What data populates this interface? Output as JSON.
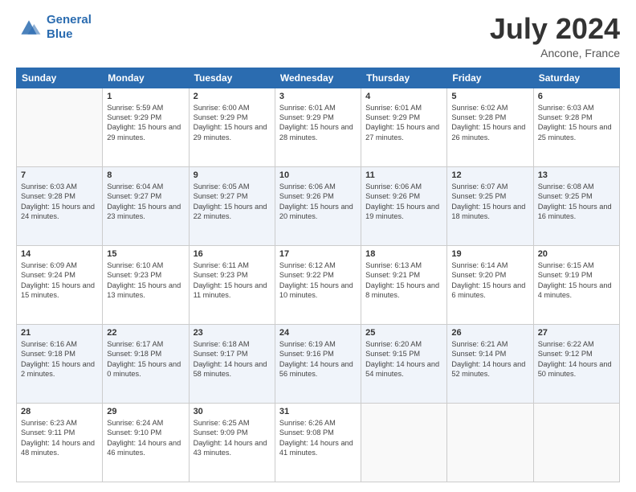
{
  "header": {
    "logo_line1": "General",
    "logo_line2": "Blue",
    "main_title": "July 2024",
    "subtitle": "Ancone, France"
  },
  "calendar": {
    "days_of_week": [
      "Sunday",
      "Monday",
      "Tuesday",
      "Wednesday",
      "Thursday",
      "Friday",
      "Saturday"
    ],
    "weeks": [
      [
        {
          "day": "",
          "sunrise": "",
          "sunset": "",
          "daylight": ""
        },
        {
          "day": "1",
          "sunrise": "Sunrise: 5:59 AM",
          "sunset": "Sunset: 9:29 PM",
          "daylight": "Daylight: 15 hours and 29 minutes."
        },
        {
          "day": "2",
          "sunrise": "Sunrise: 6:00 AM",
          "sunset": "Sunset: 9:29 PM",
          "daylight": "Daylight: 15 hours and 29 minutes."
        },
        {
          "day": "3",
          "sunrise": "Sunrise: 6:01 AM",
          "sunset": "Sunset: 9:29 PM",
          "daylight": "Daylight: 15 hours and 28 minutes."
        },
        {
          "day": "4",
          "sunrise": "Sunrise: 6:01 AM",
          "sunset": "Sunset: 9:29 PM",
          "daylight": "Daylight: 15 hours and 27 minutes."
        },
        {
          "day": "5",
          "sunrise": "Sunrise: 6:02 AM",
          "sunset": "Sunset: 9:28 PM",
          "daylight": "Daylight: 15 hours and 26 minutes."
        },
        {
          "day": "6",
          "sunrise": "Sunrise: 6:03 AM",
          "sunset": "Sunset: 9:28 PM",
          "daylight": "Daylight: 15 hours and 25 minutes."
        }
      ],
      [
        {
          "day": "7",
          "sunrise": "Sunrise: 6:03 AM",
          "sunset": "Sunset: 9:28 PM",
          "daylight": "Daylight: 15 hours and 24 minutes."
        },
        {
          "day": "8",
          "sunrise": "Sunrise: 6:04 AM",
          "sunset": "Sunset: 9:27 PM",
          "daylight": "Daylight: 15 hours and 23 minutes."
        },
        {
          "day": "9",
          "sunrise": "Sunrise: 6:05 AM",
          "sunset": "Sunset: 9:27 PM",
          "daylight": "Daylight: 15 hours and 22 minutes."
        },
        {
          "day": "10",
          "sunrise": "Sunrise: 6:06 AM",
          "sunset": "Sunset: 9:26 PM",
          "daylight": "Daylight: 15 hours and 20 minutes."
        },
        {
          "day": "11",
          "sunrise": "Sunrise: 6:06 AM",
          "sunset": "Sunset: 9:26 PM",
          "daylight": "Daylight: 15 hours and 19 minutes."
        },
        {
          "day": "12",
          "sunrise": "Sunrise: 6:07 AM",
          "sunset": "Sunset: 9:25 PM",
          "daylight": "Daylight: 15 hours and 18 minutes."
        },
        {
          "day": "13",
          "sunrise": "Sunrise: 6:08 AM",
          "sunset": "Sunset: 9:25 PM",
          "daylight": "Daylight: 15 hours and 16 minutes."
        }
      ],
      [
        {
          "day": "14",
          "sunrise": "Sunrise: 6:09 AM",
          "sunset": "Sunset: 9:24 PM",
          "daylight": "Daylight: 15 hours and 15 minutes."
        },
        {
          "day": "15",
          "sunrise": "Sunrise: 6:10 AM",
          "sunset": "Sunset: 9:23 PM",
          "daylight": "Daylight: 15 hours and 13 minutes."
        },
        {
          "day": "16",
          "sunrise": "Sunrise: 6:11 AM",
          "sunset": "Sunset: 9:23 PM",
          "daylight": "Daylight: 15 hours and 11 minutes."
        },
        {
          "day": "17",
          "sunrise": "Sunrise: 6:12 AM",
          "sunset": "Sunset: 9:22 PM",
          "daylight": "Daylight: 15 hours and 10 minutes."
        },
        {
          "day": "18",
          "sunrise": "Sunrise: 6:13 AM",
          "sunset": "Sunset: 9:21 PM",
          "daylight": "Daylight: 15 hours and 8 minutes."
        },
        {
          "day": "19",
          "sunrise": "Sunrise: 6:14 AM",
          "sunset": "Sunset: 9:20 PM",
          "daylight": "Daylight: 15 hours and 6 minutes."
        },
        {
          "day": "20",
          "sunrise": "Sunrise: 6:15 AM",
          "sunset": "Sunset: 9:19 PM",
          "daylight": "Daylight: 15 hours and 4 minutes."
        }
      ],
      [
        {
          "day": "21",
          "sunrise": "Sunrise: 6:16 AM",
          "sunset": "Sunset: 9:18 PM",
          "daylight": "Daylight: 15 hours and 2 minutes."
        },
        {
          "day": "22",
          "sunrise": "Sunrise: 6:17 AM",
          "sunset": "Sunset: 9:18 PM",
          "daylight": "Daylight: 15 hours and 0 minutes."
        },
        {
          "day": "23",
          "sunrise": "Sunrise: 6:18 AM",
          "sunset": "Sunset: 9:17 PM",
          "daylight": "Daylight: 14 hours and 58 minutes."
        },
        {
          "day": "24",
          "sunrise": "Sunrise: 6:19 AM",
          "sunset": "Sunset: 9:16 PM",
          "daylight": "Daylight: 14 hours and 56 minutes."
        },
        {
          "day": "25",
          "sunrise": "Sunrise: 6:20 AM",
          "sunset": "Sunset: 9:15 PM",
          "daylight": "Daylight: 14 hours and 54 minutes."
        },
        {
          "day": "26",
          "sunrise": "Sunrise: 6:21 AM",
          "sunset": "Sunset: 9:14 PM",
          "daylight": "Daylight: 14 hours and 52 minutes."
        },
        {
          "day": "27",
          "sunrise": "Sunrise: 6:22 AM",
          "sunset": "Sunset: 9:12 PM",
          "daylight": "Daylight: 14 hours and 50 minutes."
        }
      ],
      [
        {
          "day": "28",
          "sunrise": "Sunrise: 6:23 AM",
          "sunset": "Sunset: 9:11 PM",
          "daylight": "Daylight: 14 hours and 48 minutes."
        },
        {
          "day": "29",
          "sunrise": "Sunrise: 6:24 AM",
          "sunset": "Sunset: 9:10 PM",
          "daylight": "Daylight: 14 hours and 46 minutes."
        },
        {
          "day": "30",
          "sunrise": "Sunrise: 6:25 AM",
          "sunset": "Sunset: 9:09 PM",
          "daylight": "Daylight: 14 hours and 43 minutes."
        },
        {
          "day": "31",
          "sunrise": "Sunrise: 6:26 AM",
          "sunset": "Sunset: 9:08 PM",
          "daylight": "Daylight: 14 hours and 41 minutes."
        },
        {
          "day": "",
          "sunrise": "",
          "sunset": "",
          "daylight": ""
        },
        {
          "day": "",
          "sunrise": "",
          "sunset": "",
          "daylight": ""
        },
        {
          "day": "",
          "sunrise": "",
          "sunset": "",
          "daylight": ""
        }
      ]
    ]
  }
}
